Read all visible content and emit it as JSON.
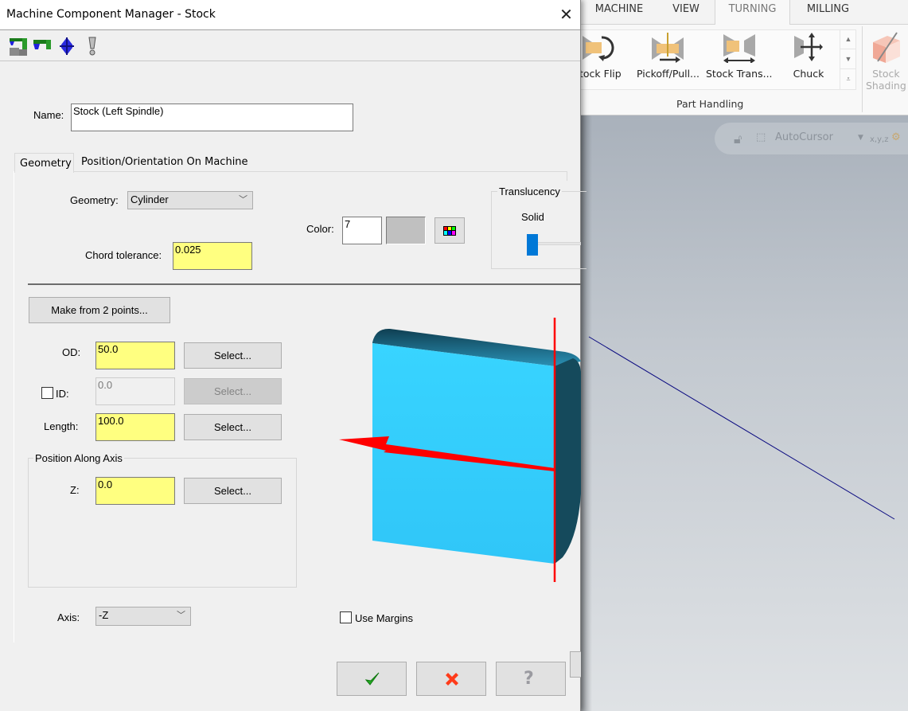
{
  "dialog": {
    "title": "Machine Component Manager - Stock",
    "close_label": "✕",
    "toolbar": [
      {
        "icon": "stock-spindle-icon"
      },
      {
        "icon": "chuck-jaws-icon"
      },
      {
        "icon": "tool-holder-icon"
      },
      {
        "icon": "warning-icon"
      }
    ],
    "name_label": "Name:",
    "name_value": "Stock (Left Spindle)",
    "tabs": [
      {
        "label": "Geometry",
        "active": true
      },
      {
        "label": "Position/Orientation On Machine",
        "active": false
      }
    ],
    "geometry": {
      "geometry_label": "Geometry:",
      "geometry_value": "Cylinder",
      "chord_label": "Chord tolerance:",
      "chord_value": "0.025",
      "color_label": "Color:",
      "color_value": "7",
      "color_swatch": "#c0c0c0",
      "translucency_title": "Translucency",
      "translucency_value_label": "Solid",
      "translucency_level": 0,
      "make_from_points": "Make from 2 points...",
      "od_label": "OD:",
      "od_value": "50.0",
      "id_label": "ID:",
      "id_checked": false,
      "id_value": "0.0",
      "length_label": "Length:",
      "length_value": "100.0",
      "select_label": "Select...",
      "position_group": "Position Along Axis",
      "z_label": "Z:",
      "z_value": "0.0",
      "axis_label": "Axis:",
      "axis_value": "-Z",
      "use_margins_label": "Use Margins",
      "use_margins_checked": false
    },
    "footer": {
      "ok_icon": "checkmark-icon",
      "cancel_icon": "x-icon",
      "help_icon": "help-icon"
    }
  },
  "app": {
    "ribbon_tabs": [
      {
        "label": "MACHINE",
        "active": false
      },
      {
        "label": "VIEW",
        "active": false
      },
      {
        "label": "TURNING",
        "active": true
      },
      {
        "label": "MILLING",
        "active": false
      }
    ],
    "ribbon_buttons": [
      {
        "label": "tock Flip"
      },
      {
        "label": "Pickoff/Pull..."
      },
      {
        "label": "Stock Trans..."
      },
      {
        "label": "Chuck"
      }
    ],
    "ribbon_group_label": "Part Handling",
    "stock_shading_label_1": "Stock",
    "stock_shading_label_2": "Shading",
    "autocursor_label": "AutoCursor",
    "xyz_label": "x,y,z"
  },
  "colors": {
    "input_highlight": "#ffff80",
    "stock_preview": "#33ccff",
    "axis_arrow": "#ff0000",
    "translucency_thumb": "#0078d7"
  }
}
